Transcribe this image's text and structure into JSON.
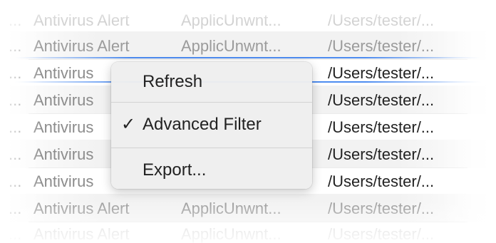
{
  "table": {
    "rows": [
      {
        "lead": "...",
        "type": "Antivirus Alert",
        "name": "ApplicUnwnt...",
        "path": "/Users/tester/..."
      },
      {
        "lead": "...",
        "type": "Antivirus Alert",
        "name": "ApplicUnwnt...",
        "path": "/Users/tester/..."
      },
      {
        "lead": "...",
        "type": "Antivirus",
        "name": "",
        "path": "/Users/tester/..."
      },
      {
        "lead": "...",
        "type": "Antivirus",
        "name": "",
        "path": "/Users/tester/..."
      },
      {
        "lead": "...",
        "type": "Antivirus",
        "name": "",
        "path": "/Users/tester/..."
      },
      {
        "lead": "...",
        "type": "Antivirus",
        "name": "",
        "path": "/Users/tester/..."
      },
      {
        "lead": "...",
        "type": "Antivirus",
        "name": "",
        "path": "/Users/tester/..."
      },
      {
        "lead": "...",
        "type": "Antivirus Alert",
        "name": "ApplicUnwnt...",
        "path": "/Users/tester/..."
      },
      {
        "lead": "...",
        "type": "Antivirus Alert",
        "name": "ApplicUnwnt...",
        "path": "/Users/tester/..."
      }
    ]
  },
  "context_menu": {
    "items": [
      {
        "label": "Refresh",
        "checked": false,
        "check_glyph": ""
      },
      {
        "label": "Advanced Filter",
        "checked": true,
        "check_glyph": "✓"
      },
      {
        "label": "Export...",
        "checked": false,
        "check_glyph": ""
      }
    ]
  },
  "colors": {
    "focus_ring": "#4d8cf0",
    "menu_background": "#eeeeee",
    "menu_text": "#222222",
    "row_text": "#8c8c8c"
  }
}
